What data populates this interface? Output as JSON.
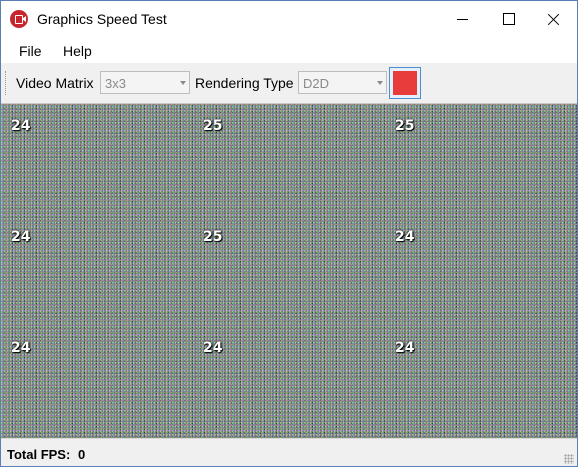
{
  "window": {
    "title": "Graphics Speed Test"
  },
  "menu": {
    "items": [
      "File",
      "Help"
    ]
  },
  "toolbar": {
    "video_matrix_label": "Video Matrix",
    "video_matrix_value": "3x3",
    "rendering_type_label": "Rendering Type",
    "rendering_type_value": "D2D",
    "color_button_color": "#e83c3c"
  },
  "grid": {
    "fps": [
      [
        "24",
        "25",
        "25"
      ],
      [
        "24",
        "25",
        "24"
      ],
      [
        "24",
        "24",
        "24"
      ]
    ]
  },
  "status": {
    "label": "Total FPS:",
    "value": "0"
  }
}
